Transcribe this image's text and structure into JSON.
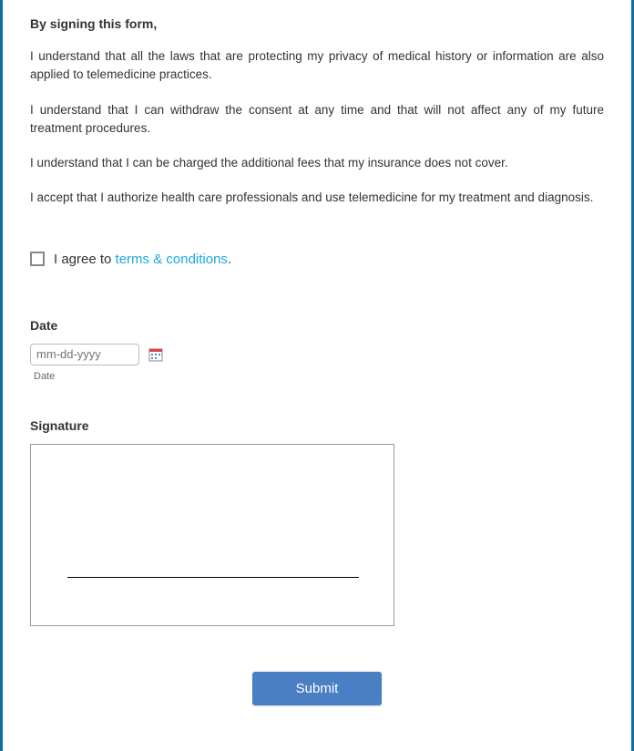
{
  "heading": "By signing this form,",
  "paragraphs": [
    "I understand that all the laws that are protecting my privacy of medical history or information are also applied to telemedicine practices.",
    "I understand that I can withdraw the consent at any time and that will not affect any of my future treatment procedures.",
    "I understand that I can be charged the additional fees that my insurance does not cover.",
    "I accept that I authorize health care professionals and use telemedicine for my treatment and diagnosis."
  ],
  "agree": {
    "prefix": "I agree to ",
    "link": "terms & conditions",
    "suffix": "."
  },
  "date": {
    "label": "Date",
    "placeholder": "mm-dd-yyyy",
    "sublabel": "Date"
  },
  "signature": {
    "label": "Signature"
  },
  "submit": {
    "label": "Submit"
  }
}
